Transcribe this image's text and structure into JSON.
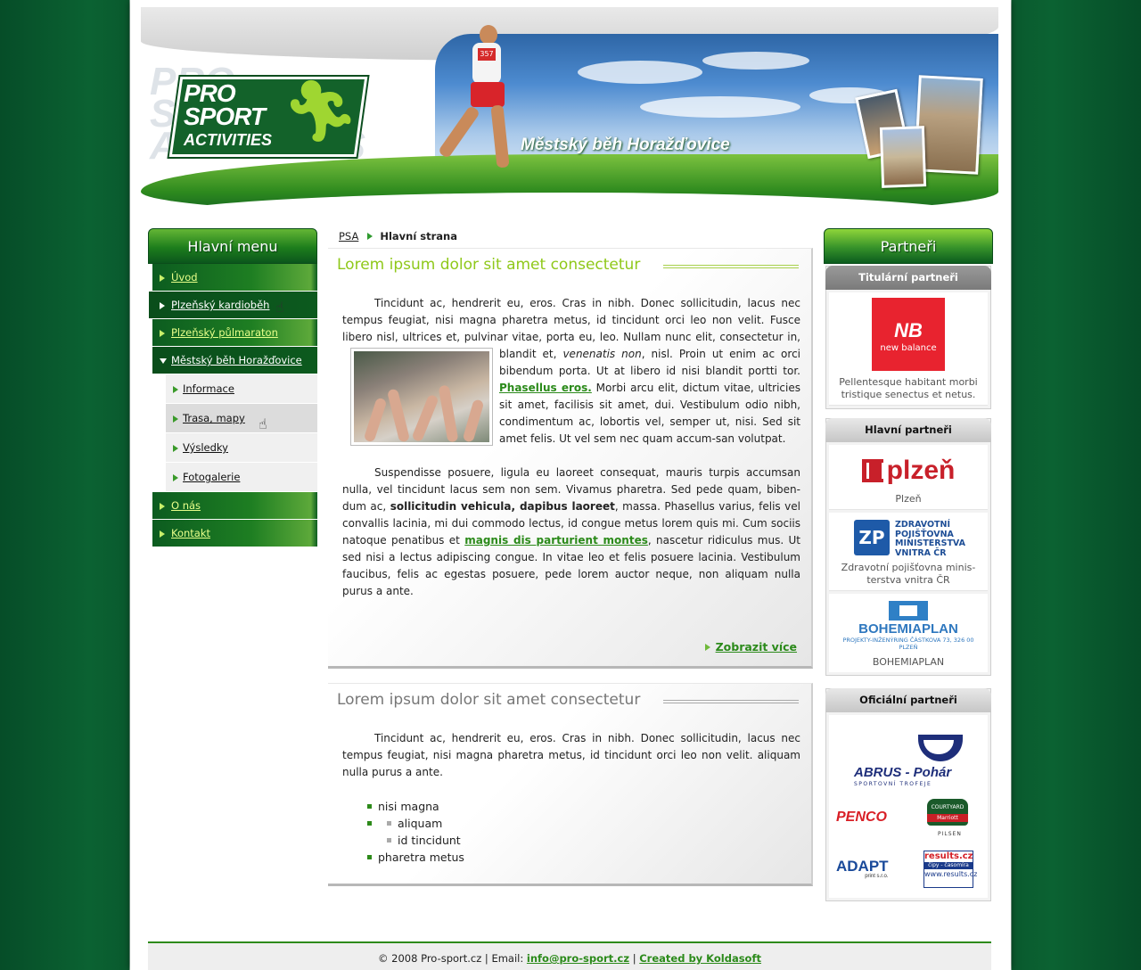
{
  "header": {
    "logo_line1": "PRO",
    "logo_line2": "SPORT",
    "logo_line3": "ACTIVITIES",
    "event_title": "Městský běh Horažďovice",
    "runner_bib": "357"
  },
  "breadcrumb": {
    "root": "PSA",
    "current": "Hlavní strana"
  },
  "main_menu": {
    "title": "Hlavní menu",
    "items": [
      {
        "label": "Úvod"
      },
      {
        "label": "Plzeňský kardioběh"
      },
      {
        "label": "Plzeňský půlmaraton"
      },
      {
        "label": "Městský běh Horažďovice"
      }
    ],
    "subitems": [
      {
        "label": "Informace"
      },
      {
        "label": "Trasa, mapy"
      },
      {
        "label": "Výsledky"
      },
      {
        "label": "Fotogalerie"
      }
    ],
    "bottom_items": [
      {
        "label": "O nás"
      },
      {
        "label": "Kontakt"
      }
    ]
  },
  "article1": {
    "title": "Lorem ipsum dolor sit amet consectetur",
    "p1_a": "Tincidunt ac, hendrerit eu, eros. Cras in nibh. Donec sollicitudin, lacus nec tempus feugiat, nisi magna pharetra metus, id tincidunt orci leo non velit. Fusce libero nisl, ultrices et, pulvinar vitae, porta eu, leo. Nullam nunc elit, consectetur in, blandit et, ",
    "p1_em": "venenatis non",
    "p1_b": ", nisl. Proin ut enim ac orci bibendum porta. Ut at libero id nisi blandit portti tor. ",
    "p1_link": "Phasellus eros.",
    "p1_c": " Morbi arcu elit, dictum vitae, ultricies sit amet, facilisis sit amet, dui. Vestibulum odio nibh, condimentum ac, lobortis vel, semper ut, nisi. Sed sit amet felis. Ut vel sem nec quam accum-san volutpat.",
    "p2_a": "Suspendisse posuere, ligula eu laoreet consequat, mauris turpis accumsan nulla, vel tincidunt lacus sem non sem. Vivamus pharetra. Sed pede quam, biben-dum ac, ",
    "p2_strong": "sollicitudin vehicula, dapibus laoreet",
    "p2_b": ", massa. Phasellus varius, felis vel convallis lacinia, mi dui commodo lectus, id congue metus lorem quis mi. Cum sociis natoque penatibus et ",
    "p2_link": "magnis dis parturient montes",
    "p2_c": ", nascetur ridiculus mus. Ut sed nisi a lectus adipiscing congue. In vitae leo et felis posuere lacinia. Vestibulum faucibus, felis ac egestas posuere, pede lorem auctor neque, non aliquam nulla purus a ante.",
    "more_label": "Zobrazit více"
  },
  "article2": {
    "title": "Lorem ipsum dolor sit amet consectetur",
    "p1": "Tincidunt ac, hendrerit eu, eros. Cras in nibh. Donec sollicitudin, lacus nec tempus feugiat, nisi magna pharetra metus, id tincidunt orci leo non velit. aliquam nulla purus a ante.",
    "list": {
      "item1": "nisi magna",
      "sub1": "aliquam",
      "sub2": "id tincidunt",
      "item2": "pharetra metus"
    }
  },
  "partners": {
    "title": "Partneři",
    "titular": {
      "heading": "Titulární partneři",
      "logo_mark": "NB",
      "logo_text": "new balance",
      "caption": "Pellentesque habitant morbi tristique senectus et netus."
    },
    "main": {
      "heading": "Hlavní partneři",
      "plzen_logo": "plzeň",
      "plzen_caption": "Plzeň",
      "zp_mark": "ZP",
      "zp_logo": "ZDRAVOTNÍ POJIŠŤOVNA MINISTERSTVA VNITRA ČR",
      "zp_caption": "Zdravotní pojišťovna minis-terstva vnitra ČR",
      "bp_logo": "BOHEMIAPLAN",
      "bp_sub": "PROJEKTY-INŽENÝRING ČÁSTKOVA 73, 326 00 PLZEŇ",
      "bp_caption": "BOHEMIAPLAN"
    },
    "official": {
      "heading": "Oficiální partneři",
      "abrus": "ABRUS - Pohár",
      "abrus_sub": "SPORTOVNÍ TROFEJE",
      "penco": "PENCO",
      "courtyard": "COURTYARD",
      "courtyard_brand": "Marriott",
      "pilsen": "PILSEN",
      "adapt": "ADAPT",
      "adapt_sub": "print s.r.o.",
      "results": "results.cz",
      "results_sub": "čipy - časomíra",
      "results_web": "www.results.cz"
    }
  },
  "footer": {
    "copyright": "© 2008 Pro-sport.cz | Email: ",
    "email": "info@pro-sport.cz",
    "sep": " | ",
    "created": "Created by Koldasoft"
  },
  "colors": {
    "brand_green": "#13622a",
    "accent_lime": "#8fc81a",
    "link_green": "#2b8a1a"
  }
}
